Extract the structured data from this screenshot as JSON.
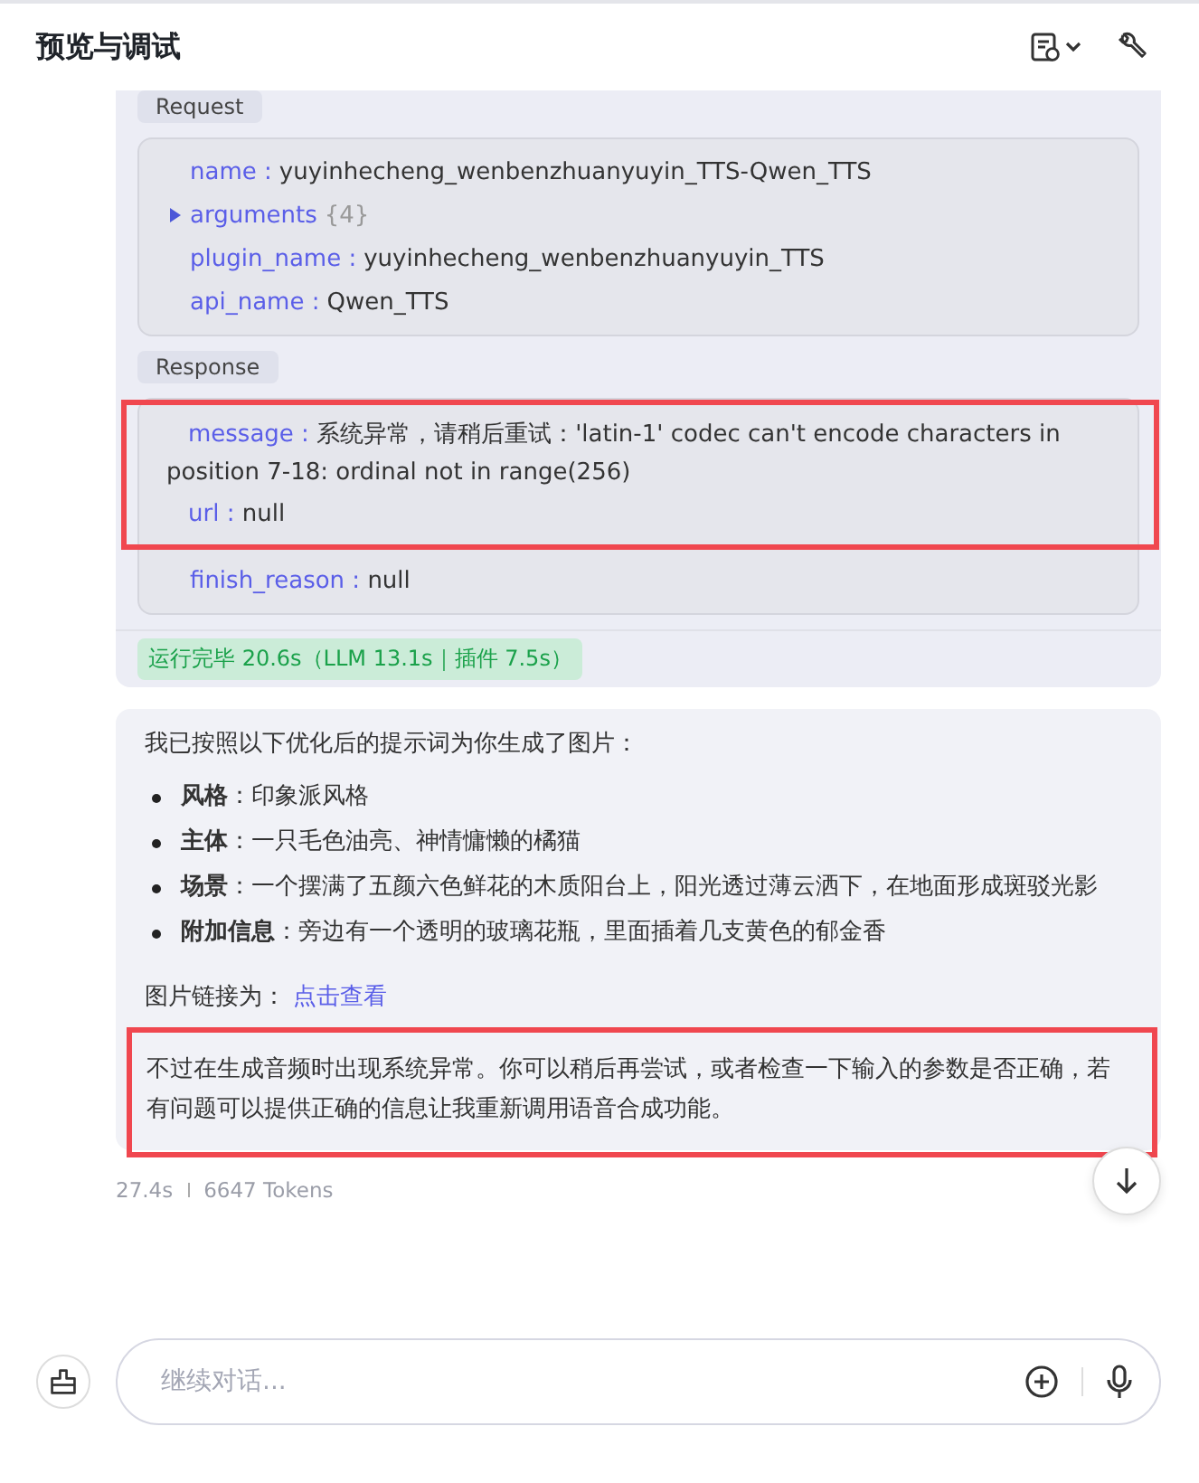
{
  "header": {
    "title": "预览与调试"
  },
  "tool_call": {
    "request_label": "Request",
    "request_fields": [
      {
        "key": "name :",
        "value": "yuyinhecheng_wenbenzhuanyuyin_TTS-Qwen_TTS",
        "kind": "pair"
      },
      {
        "key": "arguments",
        "value": "{4}",
        "kind": "collapsed",
        "expanded": false
      },
      {
        "key": "plugin_name :",
        "value": "yuyinhecheng_wenbenzhuanyuyin_TTS",
        "kind": "pair"
      },
      {
        "key": "api_name :",
        "value": "Qwen_TTS",
        "kind": "pair"
      }
    ],
    "response_label": "Response",
    "response_fields": [
      {
        "key": "message :",
        "value": "系统异常，请稍后重试：'latin-1' codec can't encode characters in position 7-18: ordinal not in range(256)",
        "highlighted": true
      },
      {
        "key": "url :",
        "value": "null",
        "highlighted": true
      },
      {
        "key": "finish_reason :",
        "value": "null",
        "highlighted": false
      }
    ],
    "status": "运行完毕 20.6s（LLM 13.1s｜插件 7.5s）"
  },
  "answer": {
    "intro": "我已按照以下优化后的提示词为你生成了图片：",
    "bullets": [
      {
        "label": "风格",
        "text": "：印象派风格"
      },
      {
        "label": "主体",
        "text": "：一只毛色油亮、神情慵懒的橘猫"
      },
      {
        "label": "场景",
        "text": "：一个摆满了五颜六色鲜花的木质阳台上，阳光透过薄云洒下，在地面形成斑驳光影"
      },
      {
        "label": "附加信息",
        "text": "：旁边有一个透明的玻璃花瓶，里面插着几支黄色的郁金香"
      }
    ],
    "link_prefix": "图片链接为：",
    "link": "点击查看",
    "closing": "不过在生成音频时出现系统异常。你可以稍后再尝试，或者检查一下输入的参数是否正确，若有问题可以提供正确的信息让我重新调用语音合成功能。",
    "closing_highlighted": true
  },
  "meta": {
    "time": "27.4s",
    "tokens": "6647 Tokens"
  },
  "input": {
    "placeholder": "继续对话..."
  }
}
